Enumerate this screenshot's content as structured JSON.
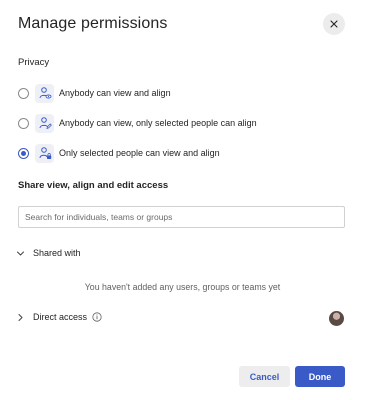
{
  "dialog": {
    "title": "Manage permissions",
    "close_icon": "close-icon"
  },
  "privacy": {
    "label": "Privacy",
    "options": [
      {
        "label": "Anybody can view and align",
        "selected": false,
        "icon": "person-view-icon"
      },
      {
        "label": "Anybody can view, only selected people can align",
        "selected": false,
        "icon": "person-edit-icon"
      },
      {
        "label": "Only selected people can view and align",
        "selected": true,
        "icon": "person-lock-icon"
      }
    ]
  },
  "share": {
    "label": "Share view, align and edit access",
    "search_placeholder": "Search for individuals, teams or groups"
  },
  "shared_with": {
    "label": "Shared with",
    "empty_message": "You haven't added any users, groups or teams yet"
  },
  "direct_access": {
    "label": "Direct access"
  },
  "buttons": {
    "cancel": "Cancel",
    "done": "Done"
  },
  "colors": {
    "accent": "#3a5bc7",
    "text": "#242424",
    "muted": "#616161"
  }
}
